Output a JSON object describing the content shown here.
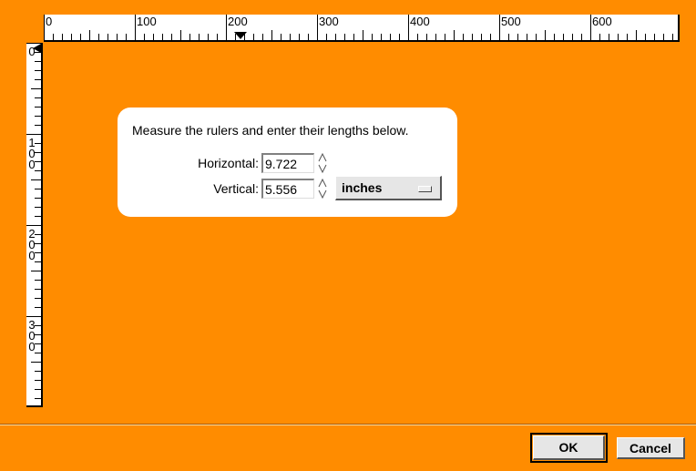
{
  "rulers": {
    "horizontal_labels": [
      "0",
      "100",
      "200",
      "300",
      "400",
      "500",
      "600"
    ],
    "vertical_labels": [
      "0",
      "100",
      "200",
      "300"
    ]
  },
  "dialog": {
    "prompt": "Measure the rulers and enter their lengths below.",
    "horizontal_label": "Horizontal:",
    "horizontal_value": "9.722",
    "vertical_label": "Vertical:",
    "vertical_value": "5.556",
    "unit_selected": "inches"
  },
  "buttons": {
    "ok": "OK",
    "cancel": "Cancel"
  },
  "colors": {
    "background": "#ff8c00",
    "ruler": "#ffffff",
    "dialog": "#ffffff",
    "button": "#e6e6e6"
  }
}
